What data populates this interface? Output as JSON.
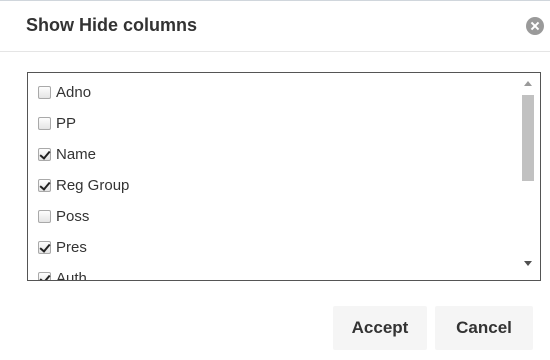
{
  "dialog": {
    "title": "Show Hide columns",
    "close_icon": "close-circle-icon"
  },
  "columns": [
    {
      "label": "Adno",
      "checked": false
    },
    {
      "label": "PP",
      "checked": false
    },
    {
      "label": "Name",
      "checked": true
    },
    {
      "label": "Reg Group",
      "checked": true
    },
    {
      "label": "Poss",
      "checked": false
    },
    {
      "label": "Pres",
      "checked": true
    },
    {
      "label": "Auth",
      "checked": true
    }
  ],
  "buttons": {
    "accept": "Accept",
    "cancel": "Cancel"
  }
}
